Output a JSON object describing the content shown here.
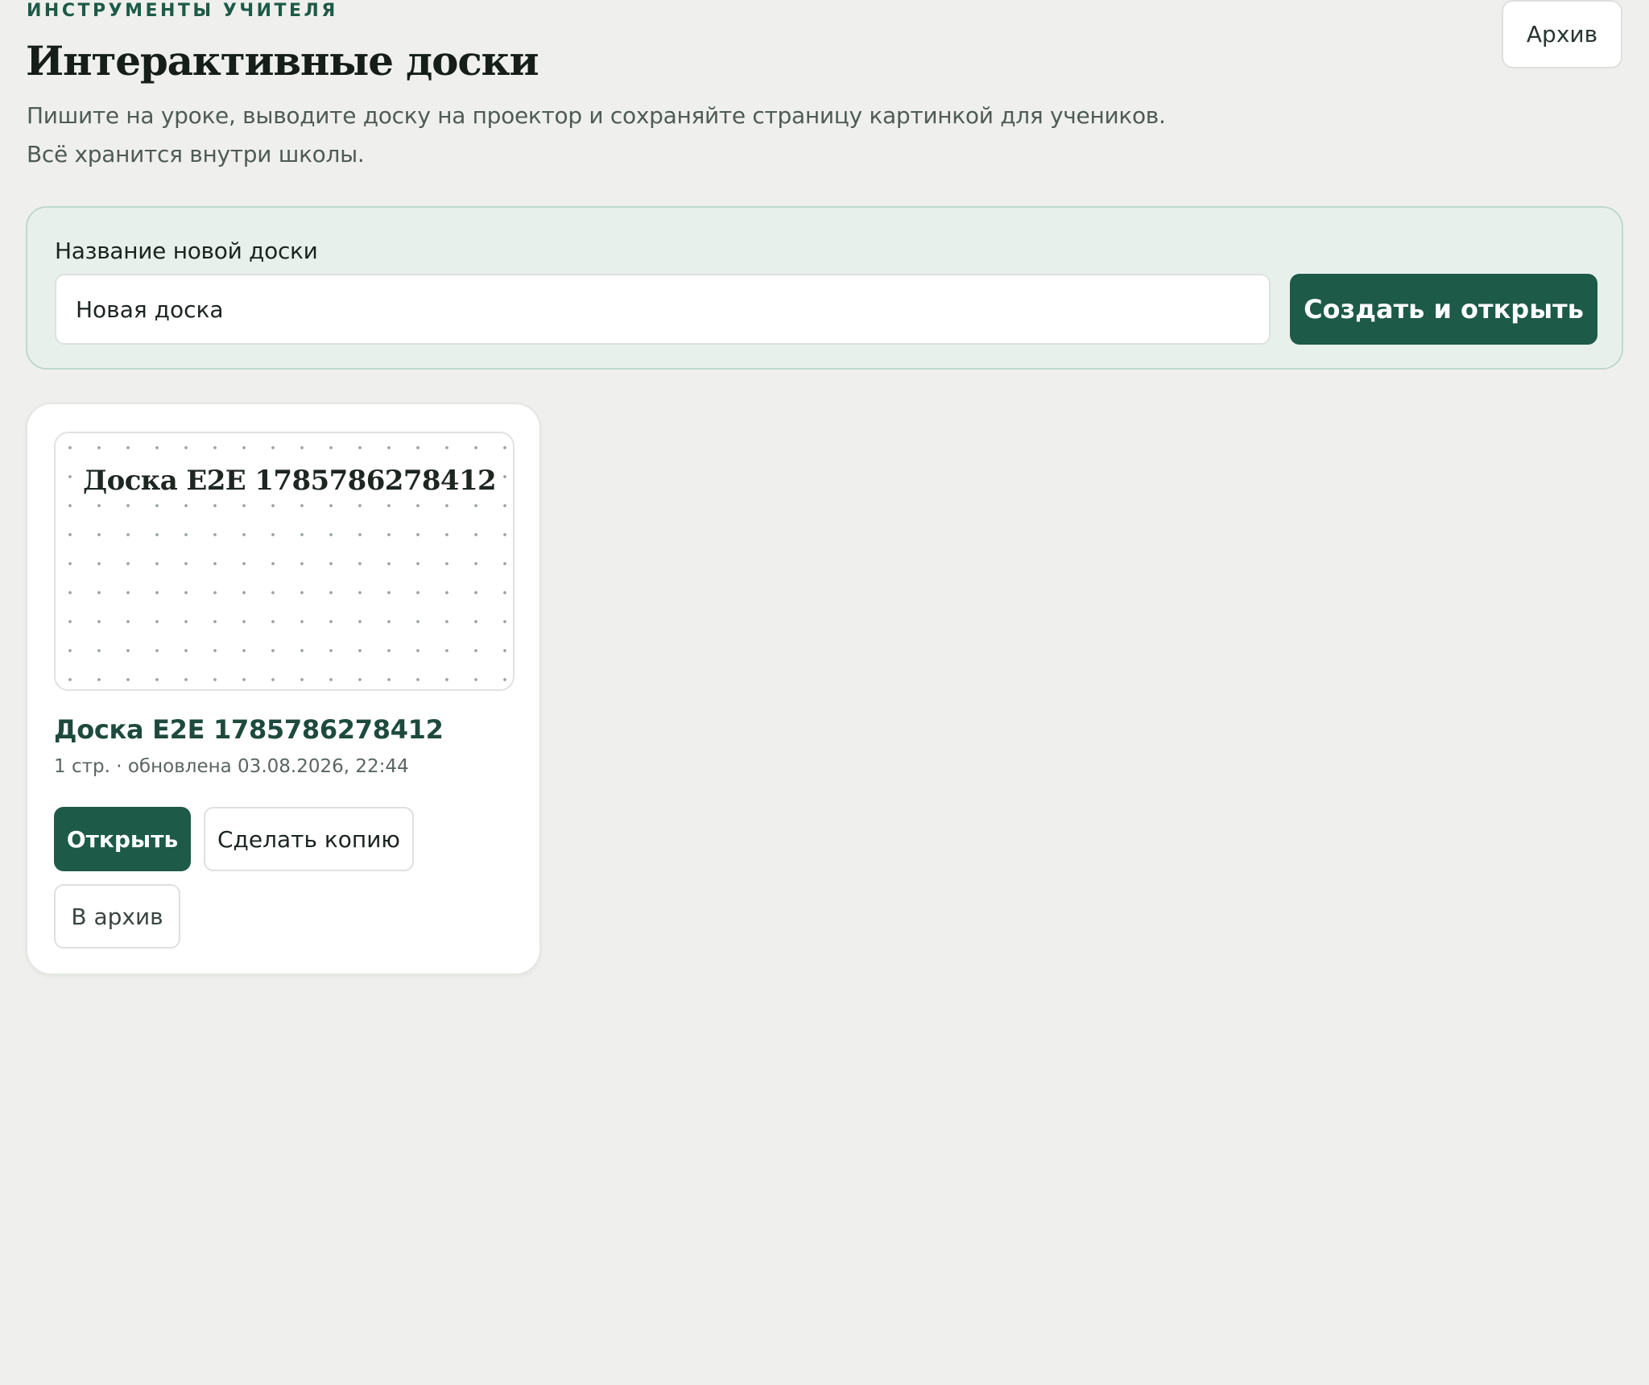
{
  "header": {
    "eyebrow": "ИНСТРУМЕНТЫ УЧИТЕЛЯ",
    "title": "Интерактивные доски",
    "description_line1": "Пишите на уроке, выводите доску на проектор и сохраняйте страницу картинкой для учеников.",
    "description_line2": "Всё хранится внутри школы.",
    "archive_button": "Архив"
  },
  "create_form": {
    "label": "Название новой доски",
    "input_value": "Новая доска",
    "submit_label": "Создать и открыть"
  },
  "boards": [
    {
      "preview_title": "Доска E2E 1785786278412",
      "title": "Доска E2E 1785786278412",
      "meta": "1 стр. · обновлена 03.08.2026, 22:44",
      "open_label": "Открыть",
      "copy_label": "Сделать копию",
      "archive_label": "В архив"
    }
  ],
  "colors": {
    "accent": "#1d5a48",
    "background": "#eff0ed",
    "panel": "#e8f0ec"
  }
}
